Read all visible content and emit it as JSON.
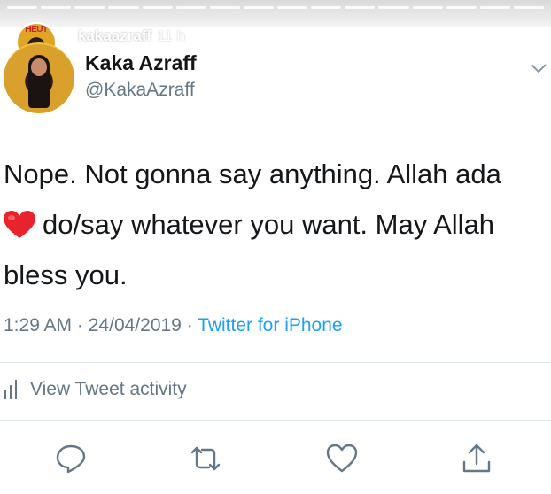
{
  "story": {
    "username": "kakaazraff",
    "time_ago": "11 h",
    "avatar_text": "HEUT"
  },
  "tweet": {
    "display_name": "Kaka Azraff",
    "handle": "@KakaAzraff",
    "text_lines": [
      "Nope. Not gonna say anything. Allah ada",
      "do/say whatever you want. May Allah",
      "bless you."
    ],
    "emoji": "red-heart",
    "time": "1:29 AM",
    "date": "24/04/2019",
    "separator": "·",
    "source": "Twitter for iPhone",
    "activity_label": "View Tweet activity"
  },
  "colors": {
    "text": "#14171a",
    "secondary": "#657786",
    "link": "#1da1f2",
    "heart": "#e8232d"
  },
  "icons": [
    "reply-icon",
    "retweet-icon",
    "like-icon",
    "share-icon",
    "chevron-down-icon",
    "activity-bars-icon"
  ]
}
